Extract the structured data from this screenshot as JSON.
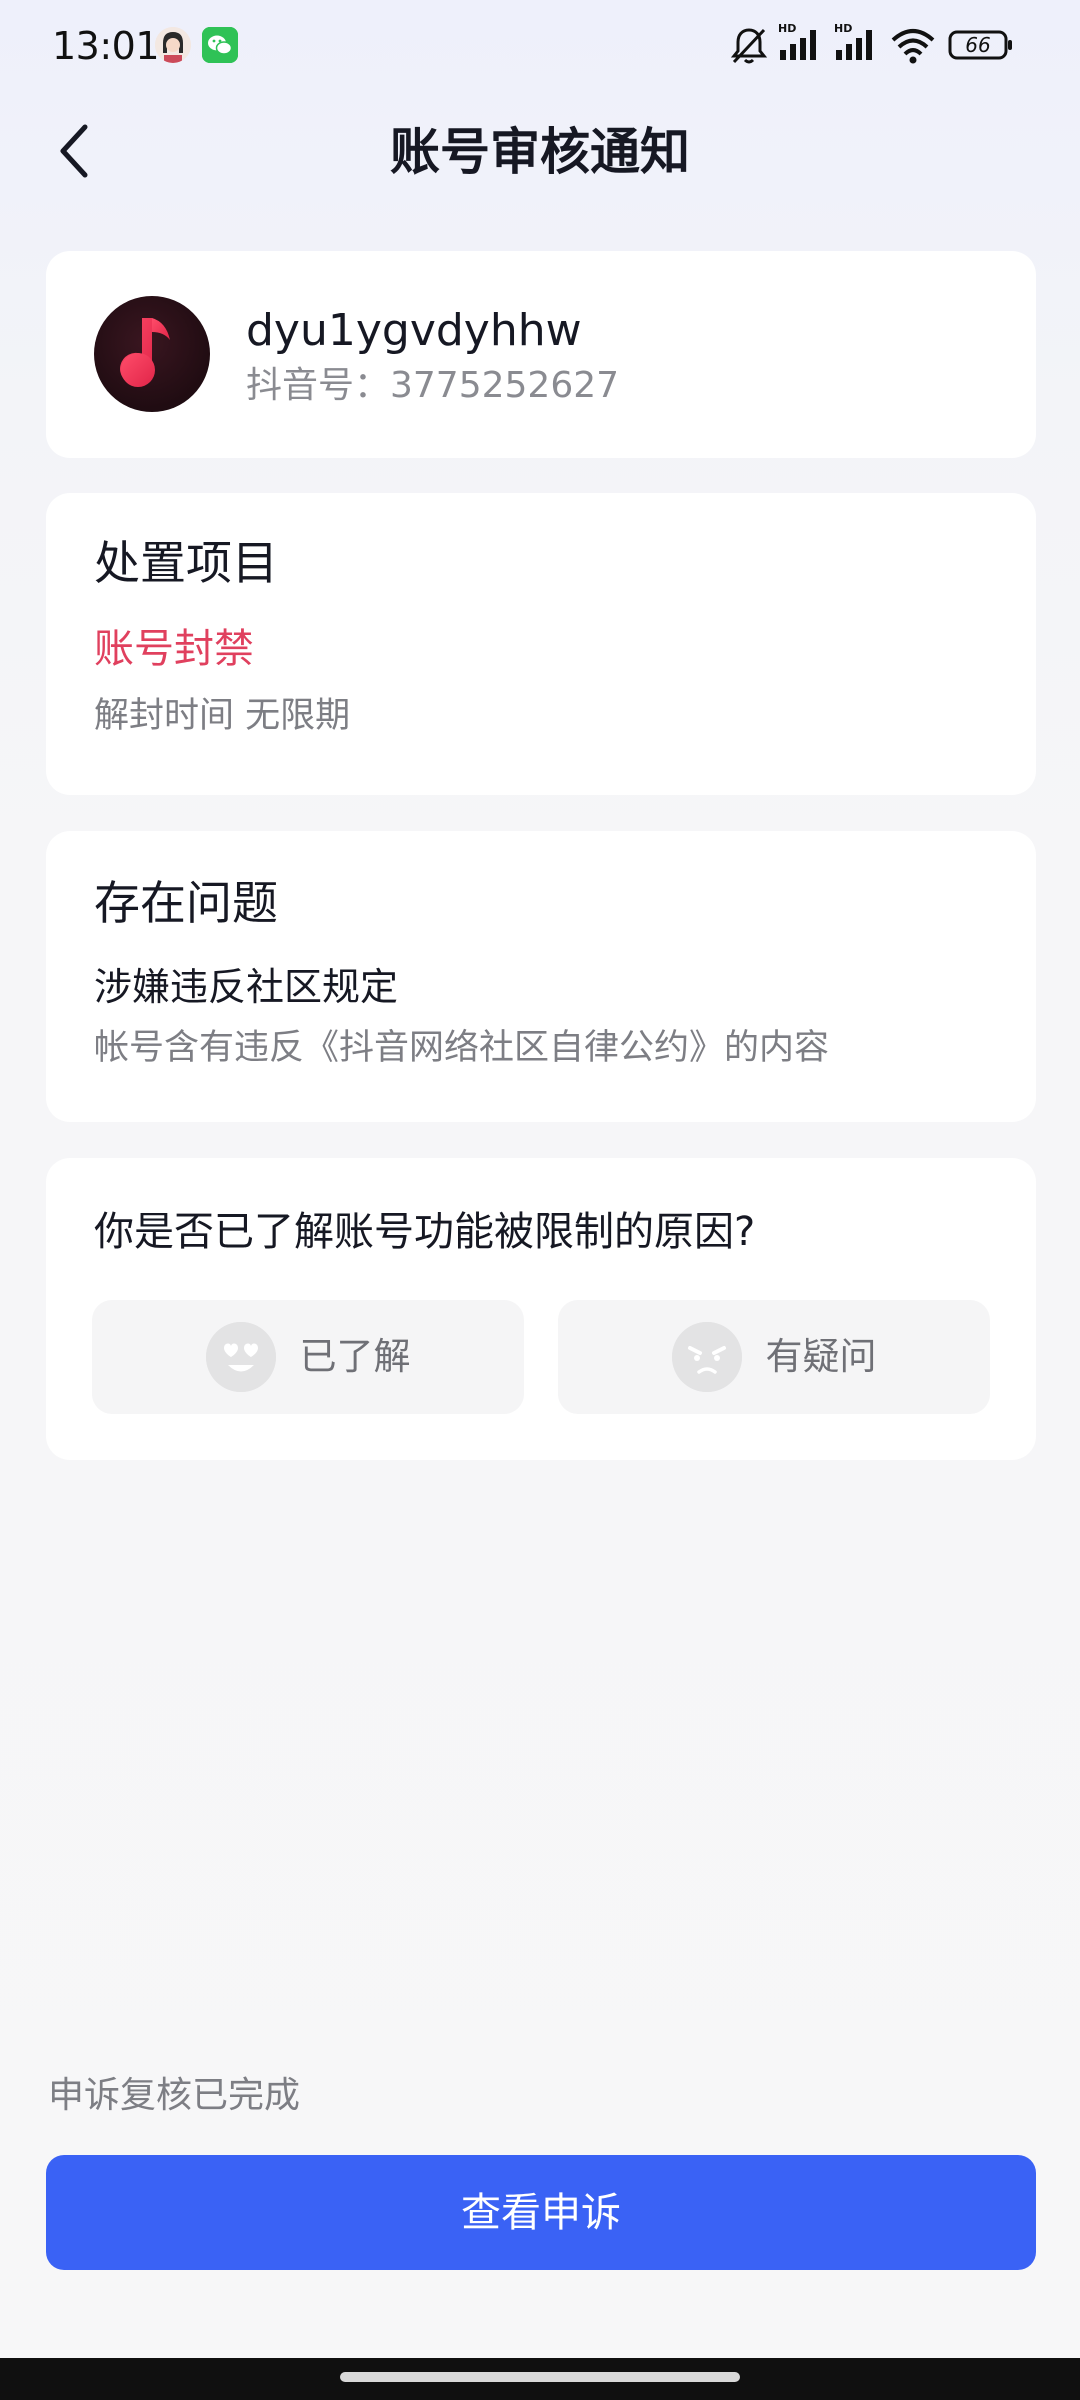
{
  "status_bar": {
    "time": "13:01",
    "battery": "66",
    "network_label_1": "HD",
    "network_label_2": "HD"
  },
  "header": {
    "title": "账号审核通知"
  },
  "user": {
    "name": "dyu1ygvdyhhw",
    "id_text": "抖音号：3775252627"
  },
  "action": {
    "heading": "处置项目",
    "value": "账号封禁",
    "detail": "解封时间 无限期"
  },
  "problem": {
    "heading": "存在问题",
    "title": "涉嫌违反社区规定",
    "description": "帐号含有违反《抖音网络社区自律公约》的内容"
  },
  "feedback": {
    "question": "你是否已了解账号功能被限制的原因?",
    "options": [
      {
        "label": "已了解",
        "icon": "heart-eyes-emoji-icon"
      },
      {
        "label": "有疑问",
        "icon": "frowning-emoji-icon"
      }
    ]
  },
  "appeal": {
    "status_text": "申诉复核已完成",
    "button_label": "查看申诉"
  },
  "colors": {
    "accent_red": "#e0405e",
    "primary_blue": "#3a62f5"
  }
}
